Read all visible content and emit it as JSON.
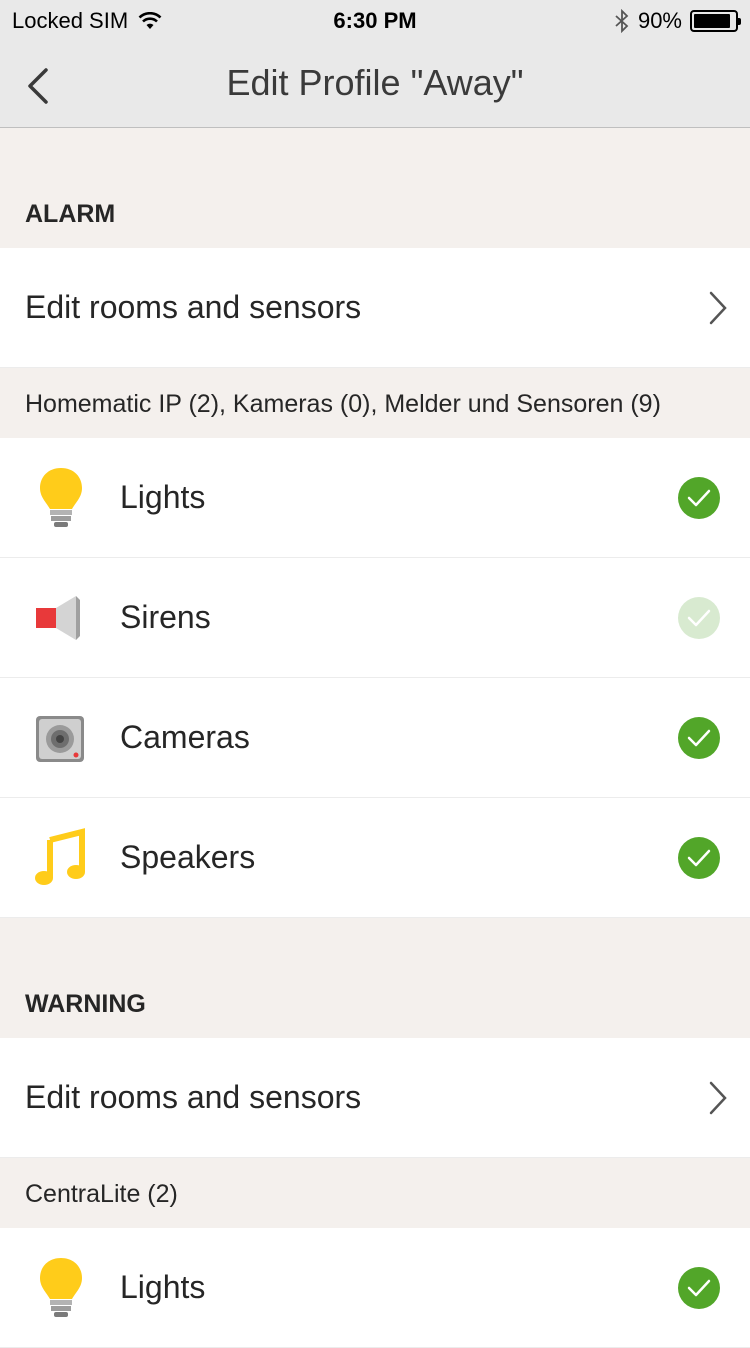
{
  "status_bar": {
    "carrier": "Locked SIM",
    "time": "6:30 PM",
    "battery_percent": "90%"
  },
  "nav": {
    "title": "Edit Profile \"Away\""
  },
  "alarm": {
    "header": "ALARM",
    "edit_label": "Edit rooms and sensors",
    "subheader": "Homematic IP (2), Kameras (0), Melder und Sensoren (9)",
    "devices": [
      {
        "label": "Lights",
        "icon": "light-bulb-icon",
        "checked": true
      },
      {
        "label": "Sirens",
        "icon": "siren-icon",
        "checked": false
      },
      {
        "label": "Cameras",
        "icon": "camera-icon",
        "checked": true
      },
      {
        "label": "Speakers",
        "icon": "music-note-icon",
        "checked": true
      }
    ]
  },
  "warning": {
    "header": "WARNING",
    "edit_label": "Edit rooms and sensors",
    "subheader": "CentraLite (2)",
    "devices": [
      {
        "label": "Lights",
        "icon": "light-bulb-icon",
        "checked": true
      }
    ]
  },
  "colors": {
    "check_on": "#52a629",
    "check_off": "#d8ead0",
    "background": "#f4f0ed",
    "bulb_yellow": "#ffcc1a",
    "siren_red": "#e8393a"
  }
}
